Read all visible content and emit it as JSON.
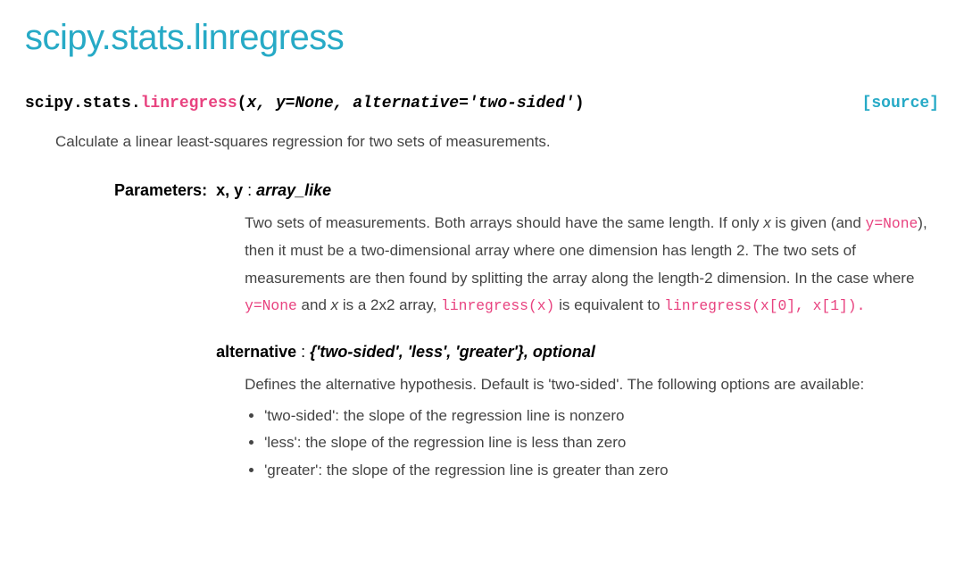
{
  "title": "scipy.stats.linregress",
  "signature": {
    "prefix": "scipy.stats.",
    "fn": "linregress",
    "open": "(",
    "args": "x, y=None, alternative='two-sided'",
    "close": ")"
  },
  "source_label": "[source]",
  "summary": "Calculate a linear least-squares regression for two sets of measurements.",
  "params_label": "Parameters:",
  "params": {
    "xy": {
      "name": "x, y",
      "sep": " : ",
      "type": "array_like",
      "desc": {
        "p1a": "Two sets of measurements. Both arrays should have the same length. If only ",
        "p1_x": "x",
        "p1b": " is given (and ",
        "code1": "y=None",
        "p1c": "), then it must be a two-dimensional array where one dimension has length 2. The two sets of measurements are then found by splitting the array along the length-2 dimension. In the case where ",
        "code2": "y=None",
        "p1d": " and ",
        "p1_x2": "x",
        "p1e": " is a 2x2 array, ",
        "code3": "linregress(x)",
        "p1f": " is equivalent to ",
        "code4": "linregress(x[0], x[1]).",
        "p1g": ""
      }
    },
    "alt": {
      "name": "alternative",
      "sep": " : ",
      "type": "{'two-sided', 'less', 'greater'}, optional",
      "desc_intro": "Defines the alternative hypothesis. Default is 'two-sided'. The following options are available:",
      "options": [
        "'two-sided': the slope of the regression line is nonzero",
        "'less': the slope of the regression line is less than zero",
        "'greater': the slope of the regression line is greater than zero"
      ]
    }
  }
}
